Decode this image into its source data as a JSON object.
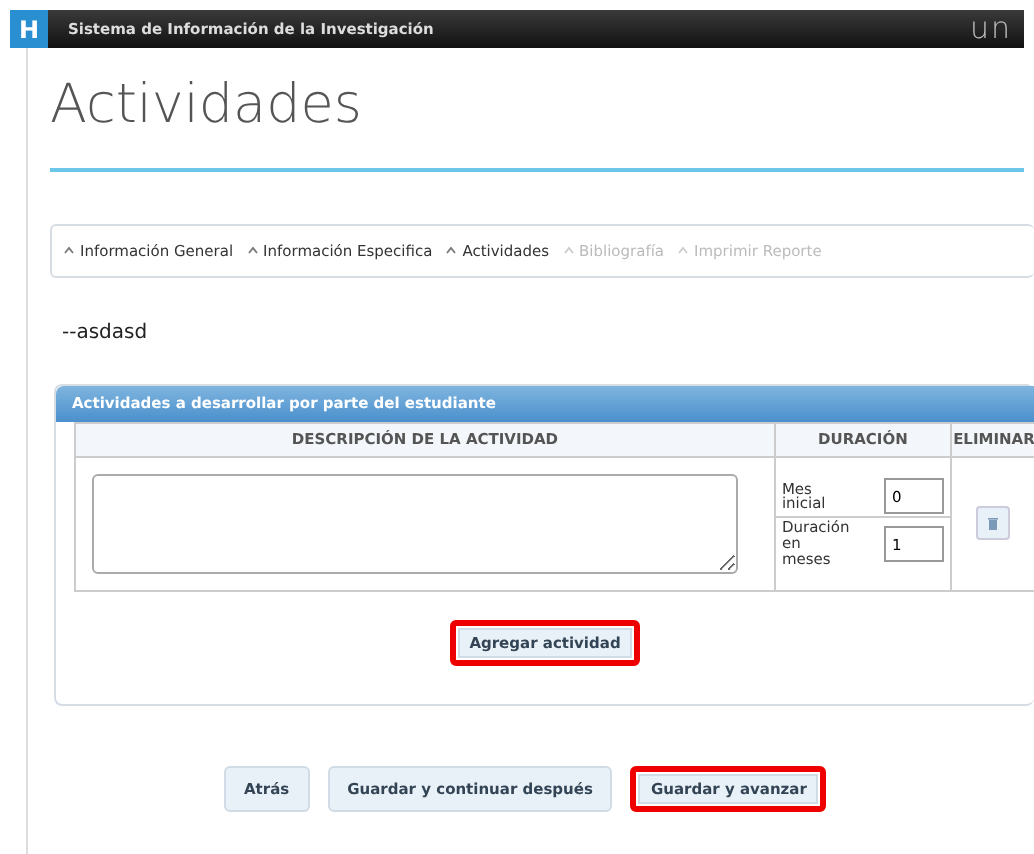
{
  "header": {
    "badge": "H",
    "title": "Sistema de Información de la Investigación",
    "logo": "un"
  },
  "page_title": "Actividades",
  "steps": [
    {
      "label": "Información General",
      "disabled": false
    },
    {
      "label": "Información Especifica",
      "disabled": false
    },
    {
      "label": "Actividades",
      "disabled": false
    },
    {
      "label": "Bibliografía",
      "disabled": true
    },
    {
      "label": "Imprimir Reporte",
      "disabled": true
    }
  ],
  "subtitle": "--asdasd",
  "panel": {
    "title": "Actividades a desarrollar por parte del estudiante",
    "columns": [
      "DESCRIPCIÓN DE LA ACTIVIDAD",
      "DURACIÓN",
      "ELIMINAR"
    ],
    "rows": [
      {
        "description": "",
        "duration_fields": [
          {
            "label": "Mes inicial",
            "value": "0"
          },
          {
            "label": "Duración en meses",
            "value": "1"
          }
        ]
      }
    ],
    "add_button": {
      "label": "Agregar actividad",
      "highlighted": true
    }
  },
  "buttons": [
    {
      "label": "Atrás",
      "highlighted": false
    },
    {
      "label": "Guardar y continuar después",
      "highlighted": false
    },
    {
      "label": "Guardar y avanzar",
      "highlighted": true
    }
  ]
}
